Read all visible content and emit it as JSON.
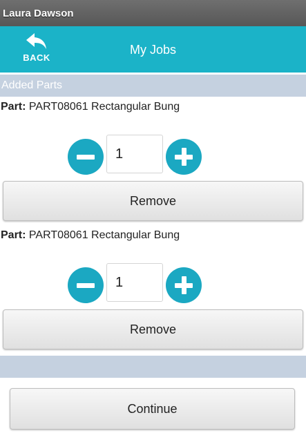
{
  "status_bar": {
    "user_name": "Laura Dawson"
  },
  "header": {
    "back_label": "BACK",
    "title": "My Jobs"
  },
  "section": {
    "title": "Added Parts"
  },
  "parts": [
    {
      "label": "Part:",
      "name": "PART08061 Rectangular Bung",
      "quantity": "1",
      "remove_label": "Remove"
    },
    {
      "label": "Part:",
      "name": "PART08061 Rectangular Bung",
      "quantity": "1",
      "remove_label": "Remove"
    }
  ],
  "actions": {
    "continue_label": "Continue"
  },
  "colors": {
    "header_bg": "#1bb3c8",
    "status_bar_bg": "#5f5f5f",
    "section_bg": "#c5d1e0",
    "round_button": "#1ba8c2"
  },
  "icons": {
    "back": "back-arrow-icon",
    "minus": "minus-icon",
    "plus": "plus-icon"
  }
}
